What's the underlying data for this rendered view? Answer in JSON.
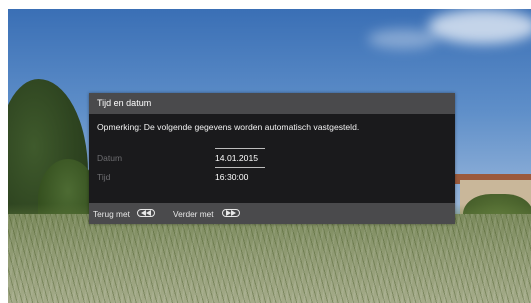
{
  "dialog": {
    "title": "Tijd en datum",
    "note": "Opmerking: De volgende gegevens worden automatisch vastgesteld.",
    "fields": [
      {
        "label": "Datum",
        "value": "14.01.2015"
      },
      {
        "label": "Tijd",
        "value": "16:30:00"
      }
    ]
  },
  "footer": {
    "back_label": "Terug met",
    "back_icon": "rewind-icon",
    "next_label": "Verder met",
    "next_icon": "fast-forward-icon"
  },
  "colors": {
    "title_bar": "#4a4a4c",
    "dialog_body": "#1a1a1c",
    "label_text": "#6d6d70",
    "value_text": "#ffffff"
  }
}
